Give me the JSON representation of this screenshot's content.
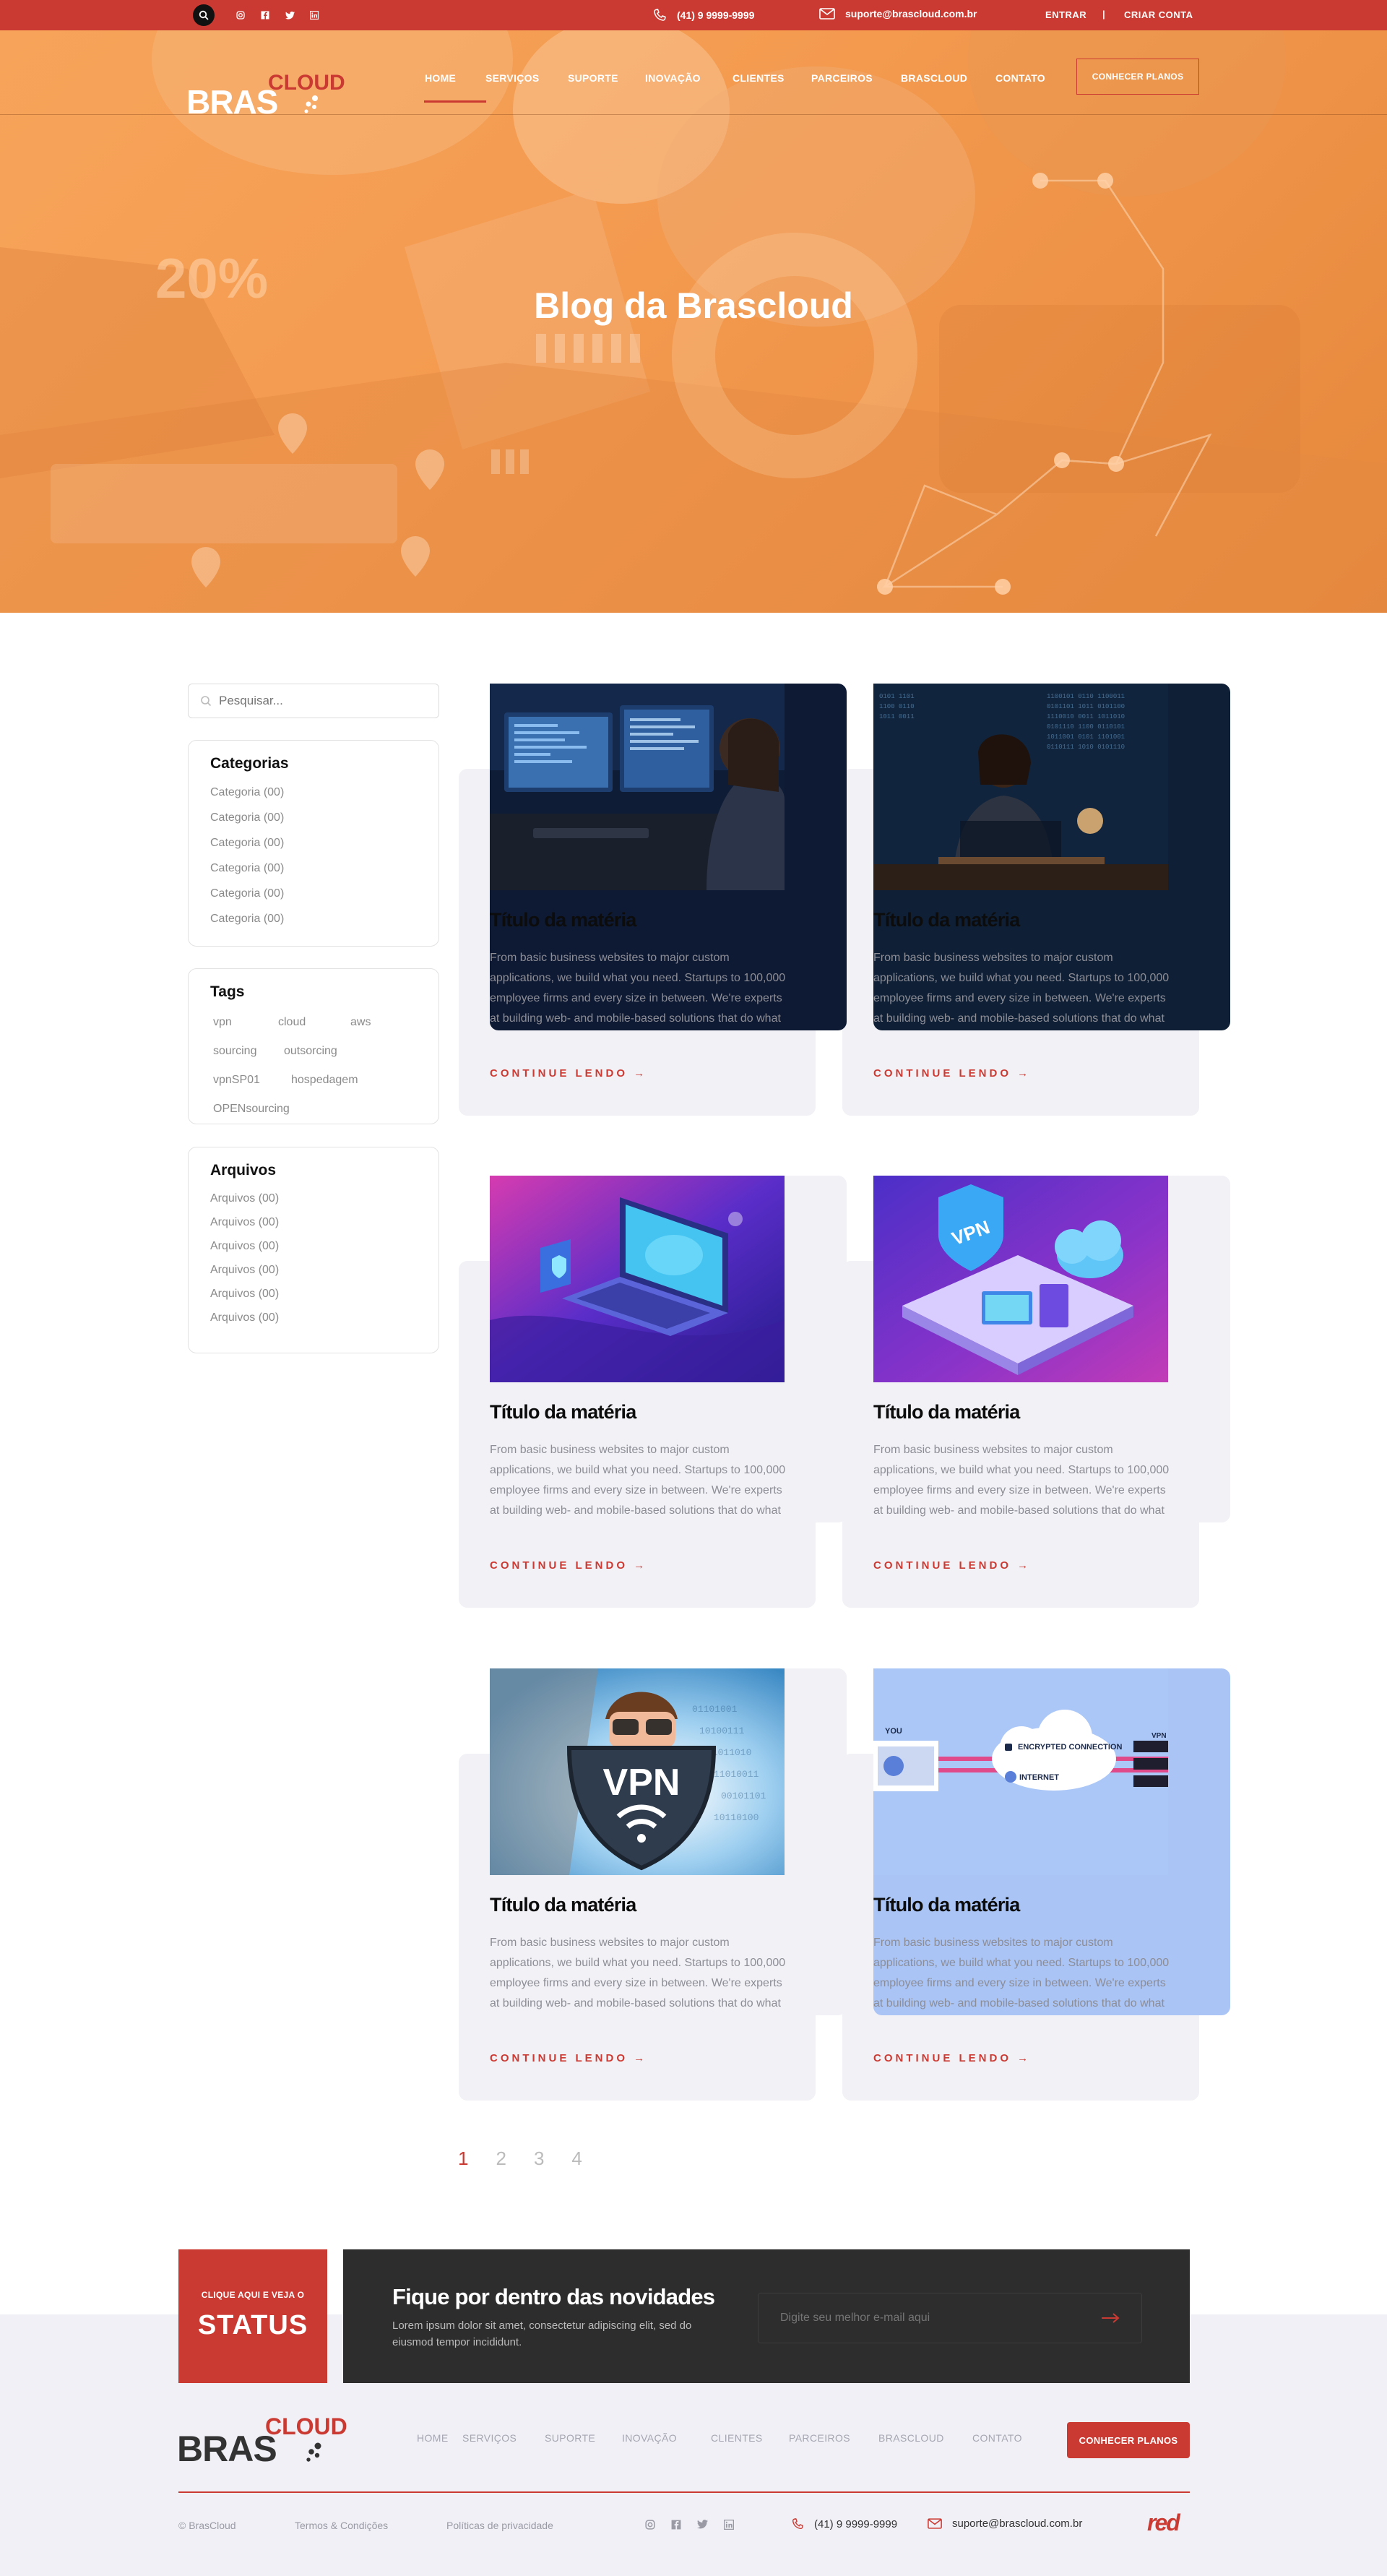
{
  "topbar": {
    "phone": "(41) 9 9999-9999",
    "email": "suporte@brascloud.com.br",
    "login": "ENTRAR",
    "separator": "|",
    "signup": "CRIAR CONTA"
  },
  "brand": {
    "name_main": "BRAS",
    "name_sup": "CLOUD"
  },
  "nav": {
    "items": [
      "HOME",
      "SERVIÇOS",
      "SUPORTE",
      "INOVAÇÃO",
      "CLIENTES",
      "PARCEIROS",
      "BRASCLOUD",
      "CONTATO"
    ],
    "active": "HOME",
    "cta": "CONHECER PLANOS"
  },
  "hero": {
    "title": "Blog da Brascloud",
    "badge": "20%"
  },
  "search": {
    "placeholder": "Pesquisar..."
  },
  "categories": {
    "title": "Categorias",
    "items": [
      "Categoria (00)",
      "Categoria (00)",
      "Categoria (00)",
      "Categoria (00)",
      "Categoria (00)",
      "Categoria (00)"
    ]
  },
  "tags": {
    "title": "Tags",
    "items": [
      "vpn",
      "cloud",
      "aws",
      "sourcing",
      "outsorcing",
      "vpnSP01",
      "hospedagem",
      "OPENsourcing"
    ]
  },
  "archives": {
    "title": "Arquivos",
    "items": [
      "Arquivos (00)",
      "Arquivos (00)",
      "Arquivos (00)",
      "Arquivos (00)",
      "Arquivos (00)",
      "Arquivos (00)"
    ]
  },
  "posts": [
    {
      "title": "Título da matéria",
      "excerpt": "From basic business websites to major custom applications, we build what you need. Startups to 100,000 employee firms and every size in between. We're experts at building web- and mobile-based solutions that do what nothing else in the off-the-shelf world can do.",
      "link": "CONTINUE LENDO →"
    },
    {
      "title": "Título da matéria",
      "excerpt": "From basic business websites to major custom applications, we build what you need. Startups to 100,000 employee firms and every size in between. We're experts at building web- and mobile-based solutions that do what nothing else in the off-the-shelf world can do.",
      "link": "CONTINUE LENDO →"
    },
    {
      "title": "Título da matéria",
      "excerpt": "From basic business websites to major custom applications, we build what you need. Startups to 100,000 employee firms and every size in between. We're experts at building web- and mobile-based solutions that do what nothing else in the off-the-shelf world can do.",
      "link": "CONTINUE LENDO →"
    },
    {
      "title": "Título da matéria",
      "excerpt": "From basic business websites to major custom applications, we build what you need. Startups to 100,000 employee firms and every size in between. We're experts at building web- and mobile-based solutions that do what nothing else in the off-the-shelf world can do.",
      "link": "CONTINUE LENDO →"
    },
    {
      "title": "Título da matéria",
      "excerpt": "From basic business websites to major custom applications, we build what you need. Startups to 100,000 employee firms and every size in between. We're experts at building web- and mobile-based solutions that do what nothing else in the off-the-shelf world can do.",
      "link": "CONTINUE LENDO →"
    },
    {
      "title": "Título da matéria",
      "excerpt": "From basic business websites to major custom applications, we build what you need. Startups to 100,000 employee firms and every size in between. We're experts at building web- and mobile-based solutions that do what nothing else in the off-the-shelf world can do.",
      "link": "CONTINUE LENDO →"
    }
  ],
  "images": {
    "vpn_badge": "VPN",
    "vpn_shield": "VPN",
    "diagram_you": "YOU",
    "diagram_encrypted": "ENCRYPTED CONNECTION",
    "diagram_internet": "INTERNET",
    "diagram_vpn": "VPN"
  },
  "pagination": {
    "pages": [
      "1",
      "2",
      "3",
      "4"
    ],
    "current": "1"
  },
  "status": {
    "small": "CLIQUE AQUI E VEJA O",
    "big": "STATUS"
  },
  "newsletter": {
    "title": "Fique por dentro das novidades",
    "text": "Lorem ipsum dolor sit amet, consectetur adipiscing elit, sed do eiusmod tempor incididunt.",
    "placeholder": "Digite seu melhor e-mail aqui"
  },
  "footer": {
    "nav": [
      "HOME",
      "SERVIÇOS",
      "SUPORTE",
      "INOVAÇÃO",
      "CLIENTES",
      "PARCEIROS",
      "BRASCLOUD",
      "CONTATO"
    ],
    "cta": "CONHECER PLANOS",
    "copyright": "© BrasCloud",
    "terms": "Termos & Condições",
    "privacy": "Políticas de privacidade",
    "phone": "(41) 9 9999-9999",
    "email": "suporte@brascloud.com.br",
    "agency": "red"
  },
  "colors": {
    "brand_red": "#cb3a32",
    "hero_orange": "#f39a4f",
    "dark_panel": "#2d2d2d",
    "footer_bg": "#f0f0f6"
  }
}
